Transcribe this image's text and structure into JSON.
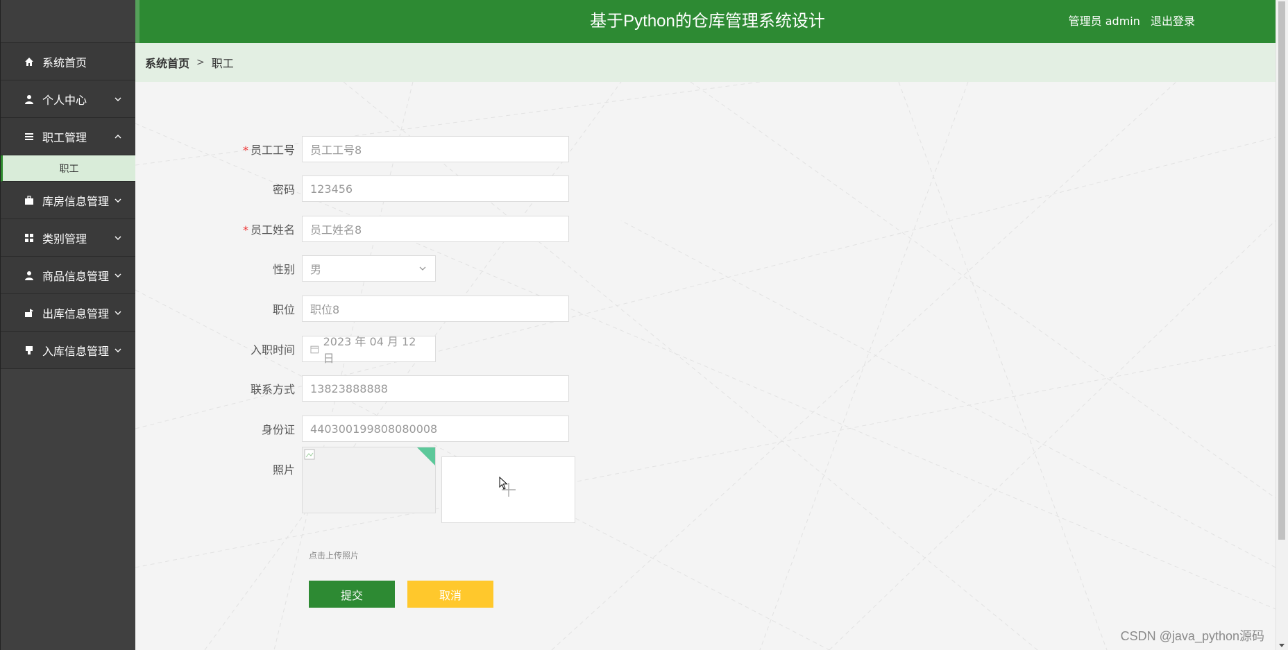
{
  "header": {
    "title": "基于Python的仓库管理系统设计",
    "user_label": "管理员 admin",
    "logout_label": "退出登录"
  },
  "breadcrumb": {
    "home": "系统首页",
    "separator": ">",
    "current": "职工"
  },
  "sidebar": {
    "items": [
      {
        "label": "系统首页",
        "icon": "home-icon"
      },
      {
        "label": "个人中心",
        "icon": "user-icon"
      },
      {
        "label": "职工管理",
        "icon": "list-icon",
        "expanded": true
      },
      {
        "label": "库房信息管理",
        "icon": "briefcase-icon"
      },
      {
        "label": "类别管理",
        "icon": "grid-icon"
      },
      {
        "label": "商品信息管理",
        "icon": "user-icon"
      },
      {
        "label": "出库信息管理",
        "icon": "box-out-icon"
      },
      {
        "label": "入库信息管理",
        "icon": "box-in-icon"
      }
    ],
    "submenu": {
      "label": "职工"
    }
  },
  "form": {
    "employee_no": {
      "label": "员工工号",
      "placeholder": "员工工号8",
      "required": true
    },
    "password": {
      "label": "密码",
      "value": "123456"
    },
    "employee_name": {
      "label": "员工姓名",
      "placeholder": "员工姓名8",
      "required": true
    },
    "gender": {
      "label": "性别",
      "value": "男"
    },
    "position": {
      "label": "职位",
      "placeholder": "职位8"
    },
    "hire_date": {
      "label": "入职时间",
      "value": "2023 年 04 月 12 日"
    },
    "phone": {
      "label": "联系方式",
      "value": "13823888888"
    },
    "id_card": {
      "label": "身份证",
      "value": "440300199808080008"
    },
    "photo": {
      "label": "照片",
      "hint": "点击上传照片"
    },
    "submit_label": "提交",
    "cancel_label": "取消"
  },
  "watermark": "CSDN @java_python源码",
  "colors": {
    "header": "#2d8a33",
    "sidebar": "#3a3a3a",
    "breadcrumb_bg": "#e3efe3",
    "submit": "#2d8a33",
    "cancel": "#ffc82c",
    "required": "#e33333"
  }
}
